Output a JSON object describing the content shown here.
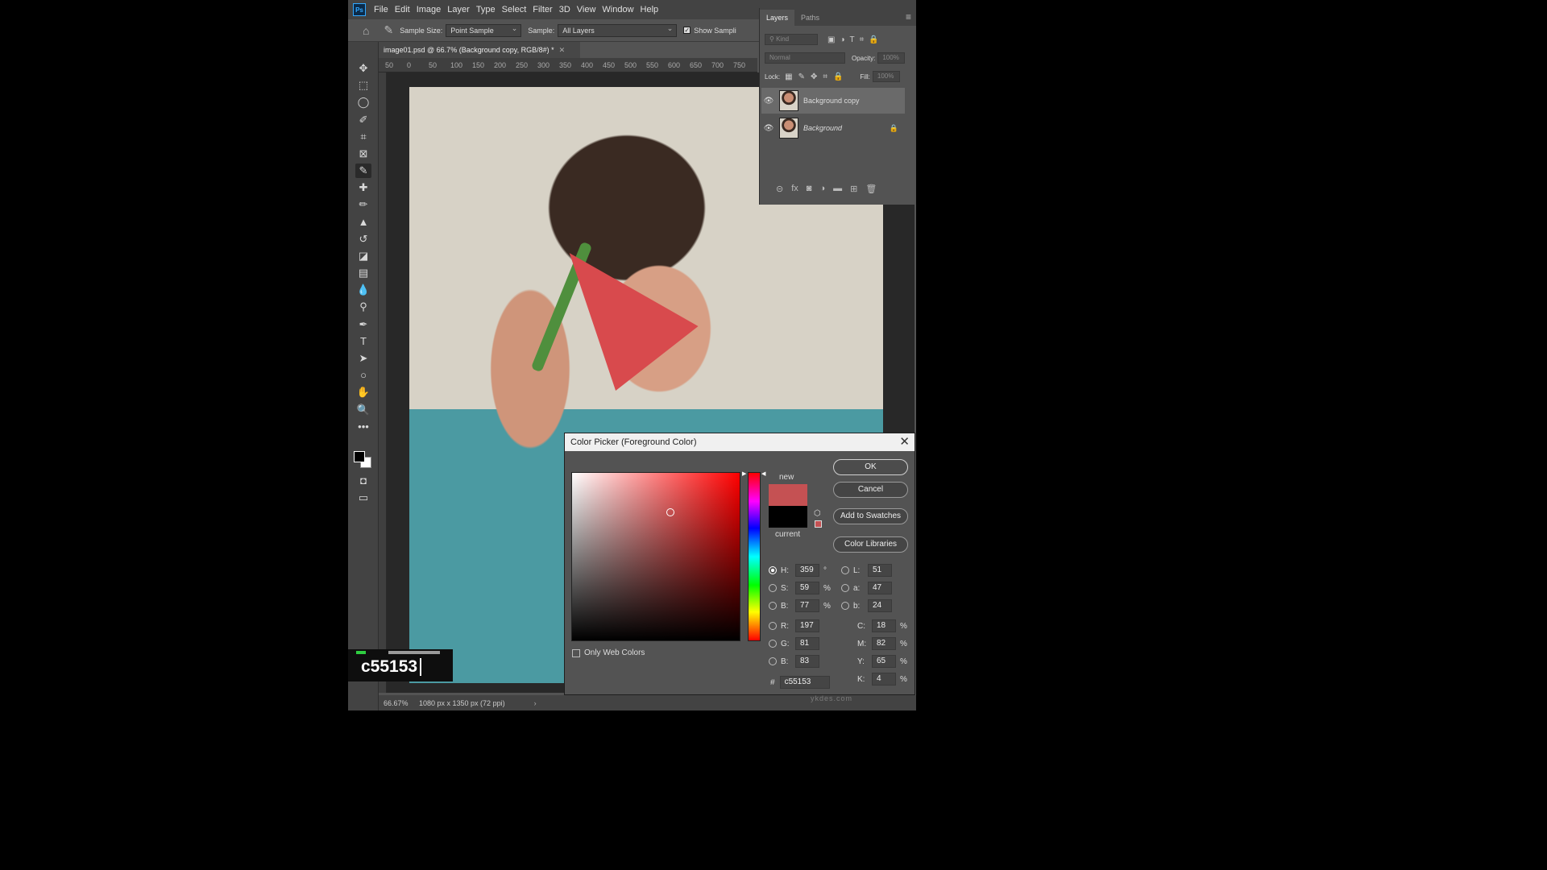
{
  "app": {
    "logo": "Ps"
  },
  "menu": [
    "File",
    "Edit",
    "Image",
    "Layer",
    "Type",
    "Select",
    "Filter",
    "3D",
    "View",
    "Window",
    "Help"
  ],
  "options_bar": {
    "sample_size_label": "Sample Size:",
    "sample_size_value": "Point Sample",
    "sample_label": "Sample:",
    "sample_value": "All Layers",
    "show_sampling_label": "Show Sampli"
  },
  "document": {
    "tab_title": "image01.psd @ 66.7% (Background copy, RGB/8#) *",
    "ruler_ticks": [
      "50",
      "0",
      "50",
      "100",
      "150",
      "200",
      "250",
      "300",
      "350",
      "400",
      "450",
      "500",
      "550",
      "600",
      "650",
      "700",
      "750"
    ]
  },
  "status_bar": {
    "zoom": "66.67%",
    "doc_info": "1080 px x 1350 px (72 ppi)"
  },
  "hex_overlay": {
    "text": "c55153"
  },
  "layers_panel": {
    "tabs": [
      "Layers",
      "Paths"
    ],
    "kind_placeholder": "Kind",
    "blend_mode": "Normal",
    "opacity_label": "Opacity:",
    "opacity_value": "100%",
    "lock_label": "Lock:",
    "fill_label": "Fill:",
    "fill_value": "100%",
    "layers": [
      {
        "name": "Background copy",
        "selected": true,
        "locked": false
      },
      {
        "name": "Background",
        "selected": false,
        "locked": true
      }
    ]
  },
  "color_picker": {
    "title": "Color Picker (Foreground Color)",
    "new_label": "new",
    "current_label": "current",
    "new_color": "#c55153",
    "current_color": "#000000",
    "buttons": {
      "ok": "OK",
      "cancel": "Cancel",
      "add_to_swatches": "Add to Swatches",
      "color_libraries": "Color Libraries"
    },
    "only_web_colors": "Only Web Colors",
    "hsb": {
      "h": "359",
      "s": "59",
      "b": "77",
      "h_unit": "°",
      "s_unit": "%",
      "b_unit": "%"
    },
    "lab": {
      "l": "51",
      "a": "47",
      "b": "24"
    },
    "rgb": {
      "r": "197",
      "g": "81",
      "b": "83"
    },
    "cmyk": {
      "c": "18",
      "m": "82",
      "y": "65",
      "k": "4",
      "unit": "%"
    },
    "hex": "c55153",
    "labels": {
      "h": "H:",
      "s": "S:",
      "bb": "B:",
      "l": "L:",
      "a": "a:",
      "lb": "b:",
      "r": "R:",
      "g": "G:",
      "rb": "B:",
      "c": "C:",
      "m": "M:",
      "y": "Y:",
      "k": "K:",
      "hash": "#"
    }
  },
  "watermark": "ykdes.com"
}
